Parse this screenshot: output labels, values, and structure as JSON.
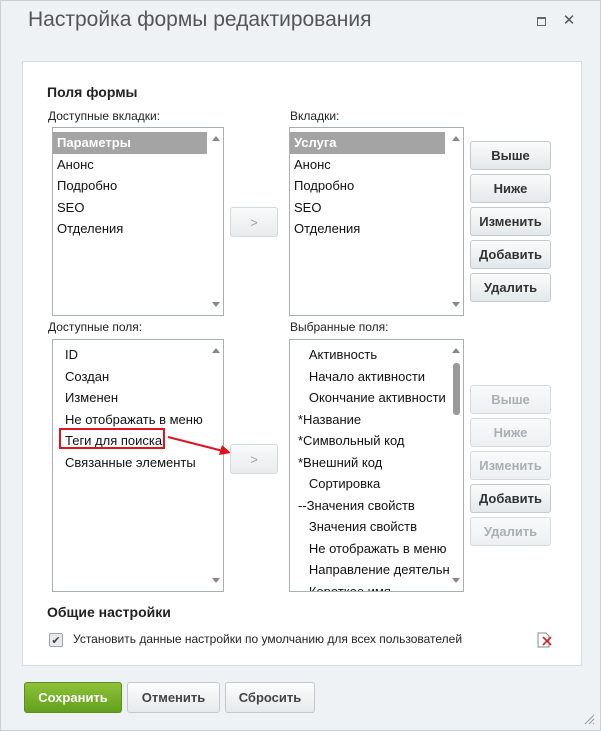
{
  "window": {
    "title": "Настройка формы редактирования"
  },
  "form_fields": {
    "section_title": "Поля формы",
    "available_tabs_label": "Доступные вкладки:",
    "available_tabs": [
      "Параметры",
      "Анонс",
      "Подробно",
      "SEO",
      "Отделения"
    ],
    "tabs_label": "Вкладки:",
    "tabs": [
      "Услуга",
      "Анонс",
      "Подробно",
      "SEO",
      "Отделения"
    ],
    "move_tab_label": ">",
    "tab_buttons": {
      "up": "Выше",
      "down": "Ниже",
      "edit": "Изменить",
      "add": "Добавить",
      "delete": "Удалить"
    },
    "available_fields_label": "Доступные поля:",
    "available_fields": [
      "ID",
      "Создан",
      "Изменен",
      "Не отображать в меню с",
      "Теги для поиска",
      "Связанные элементы"
    ],
    "selected_fields_label": "Выбранные поля:",
    "selected_fields": [
      "   Активность",
      "   Начало активности",
      "   Окончание активности",
      "*Название",
      "*Символьный код",
      "*Внешний код",
      "   Сортировка",
      "--Значения свойств",
      "   Значения свойств",
      "   Не отображать в меню",
      "   Направление деятельно",
      "   Короткое имя"
    ],
    "move_field_label": ">",
    "field_buttons": {
      "up": "Выше",
      "down": "Ниже",
      "edit": "Изменить",
      "add": "Добавить",
      "delete": "Удалить"
    }
  },
  "general": {
    "section_title": "Общие настройки",
    "default_checkbox_label": "Установить данные настройки по умолчанию для всех пользователей",
    "default_checkbox_checked": true
  },
  "footer": {
    "save": "Сохранить",
    "cancel": "Отменить",
    "reset": "Сбросить"
  },
  "colors": {
    "save_button": "#73ad26",
    "annotation": "#e0131f",
    "selected_item": "#a4a4a4"
  }
}
